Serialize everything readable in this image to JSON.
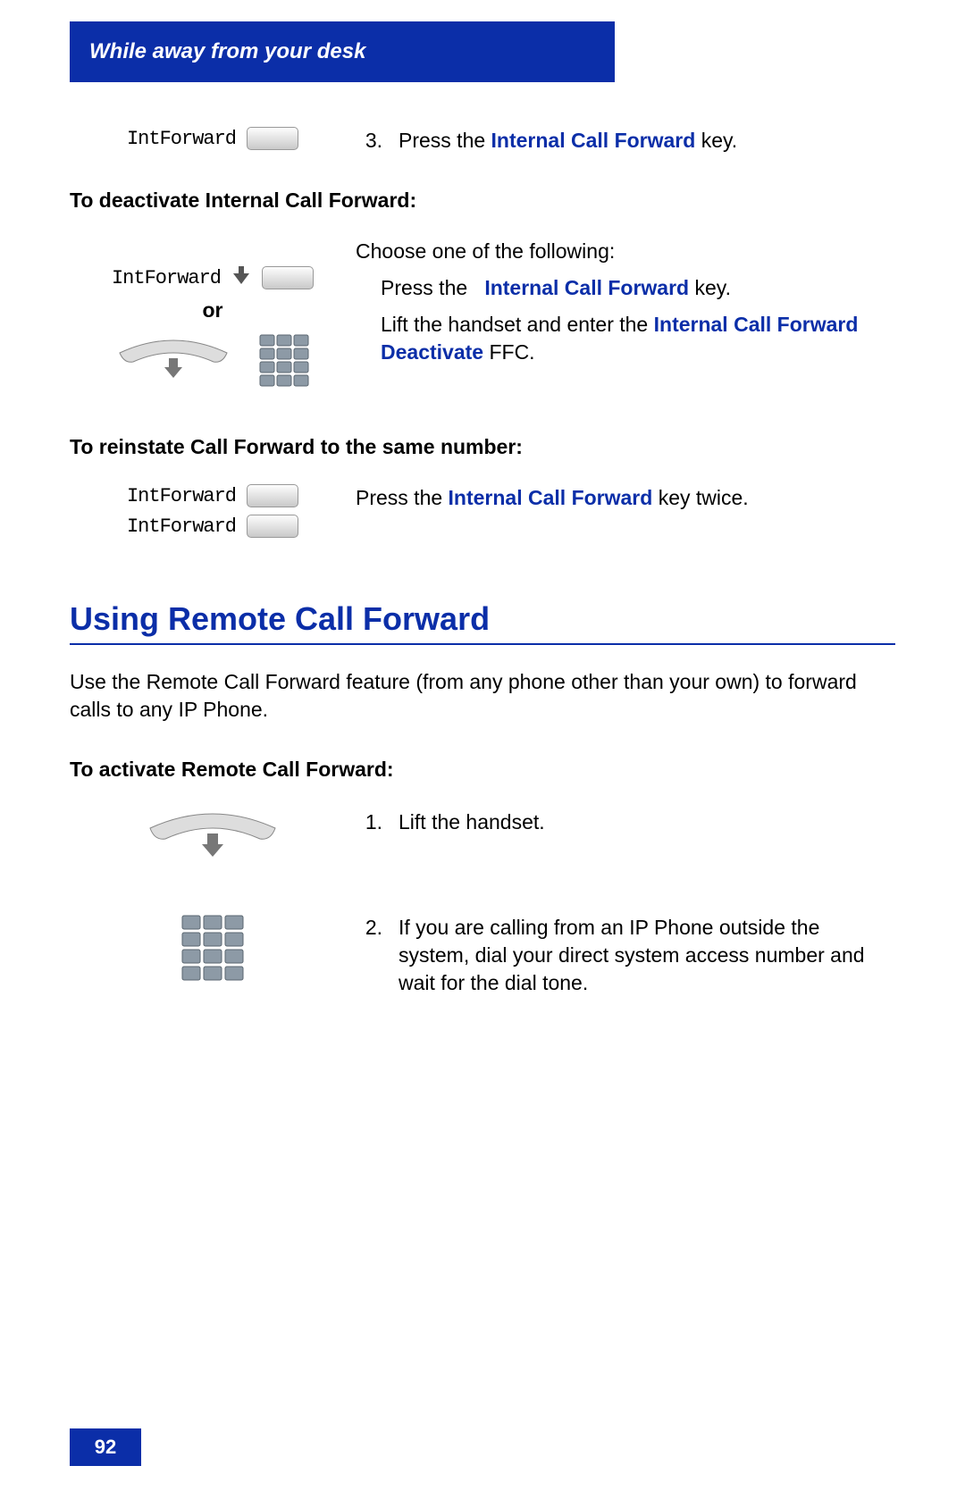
{
  "header": {
    "title": "While away from your desk"
  },
  "sec1": {
    "label": "IntForward",
    "num": "3.",
    "text_a": "Press the ",
    "link": "Internal Call Forward",
    "text_b": " key."
  },
  "sec2": {
    "heading": "To deactivate Internal Call Forward:",
    "label": "IntForward",
    "or": "or",
    "intro": "Choose one of the following:",
    "opt1_a": "Press the ",
    "opt1_link": "Internal Call Forward",
    "opt1_b": " key.",
    "opt2_a": "Lift the handset and enter the ",
    "opt2_link": "Internal Call Forward Deactivate",
    "opt2_b": " FFC."
  },
  "sec3": {
    "heading": "To reinstate Call Forward to the same number:",
    "label1": "IntForward",
    "label2": "IntForward",
    "text_a": "Press the ",
    "link": "Internal Call Forward",
    "text_b": " key twice."
  },
  "main": {
    "heading": "Using Remote Call Forward",
    "intro": "Use the Remote Call Forward feature (from any phone other than your own) to forward calls to any IP Phone.",
    "sub": "To activate Remote Call Forward:"
  },
  "step1": {
    "num": "1.",
    "text": "Lift the handset."
  },
  "step2": {
    "num": "2.",
    "text": "If you are calling from an IP Phone outside the system, dial your direct system access number and wait for the dial tone."
  },
  "footer": {
    "page": "92"
  }
}
